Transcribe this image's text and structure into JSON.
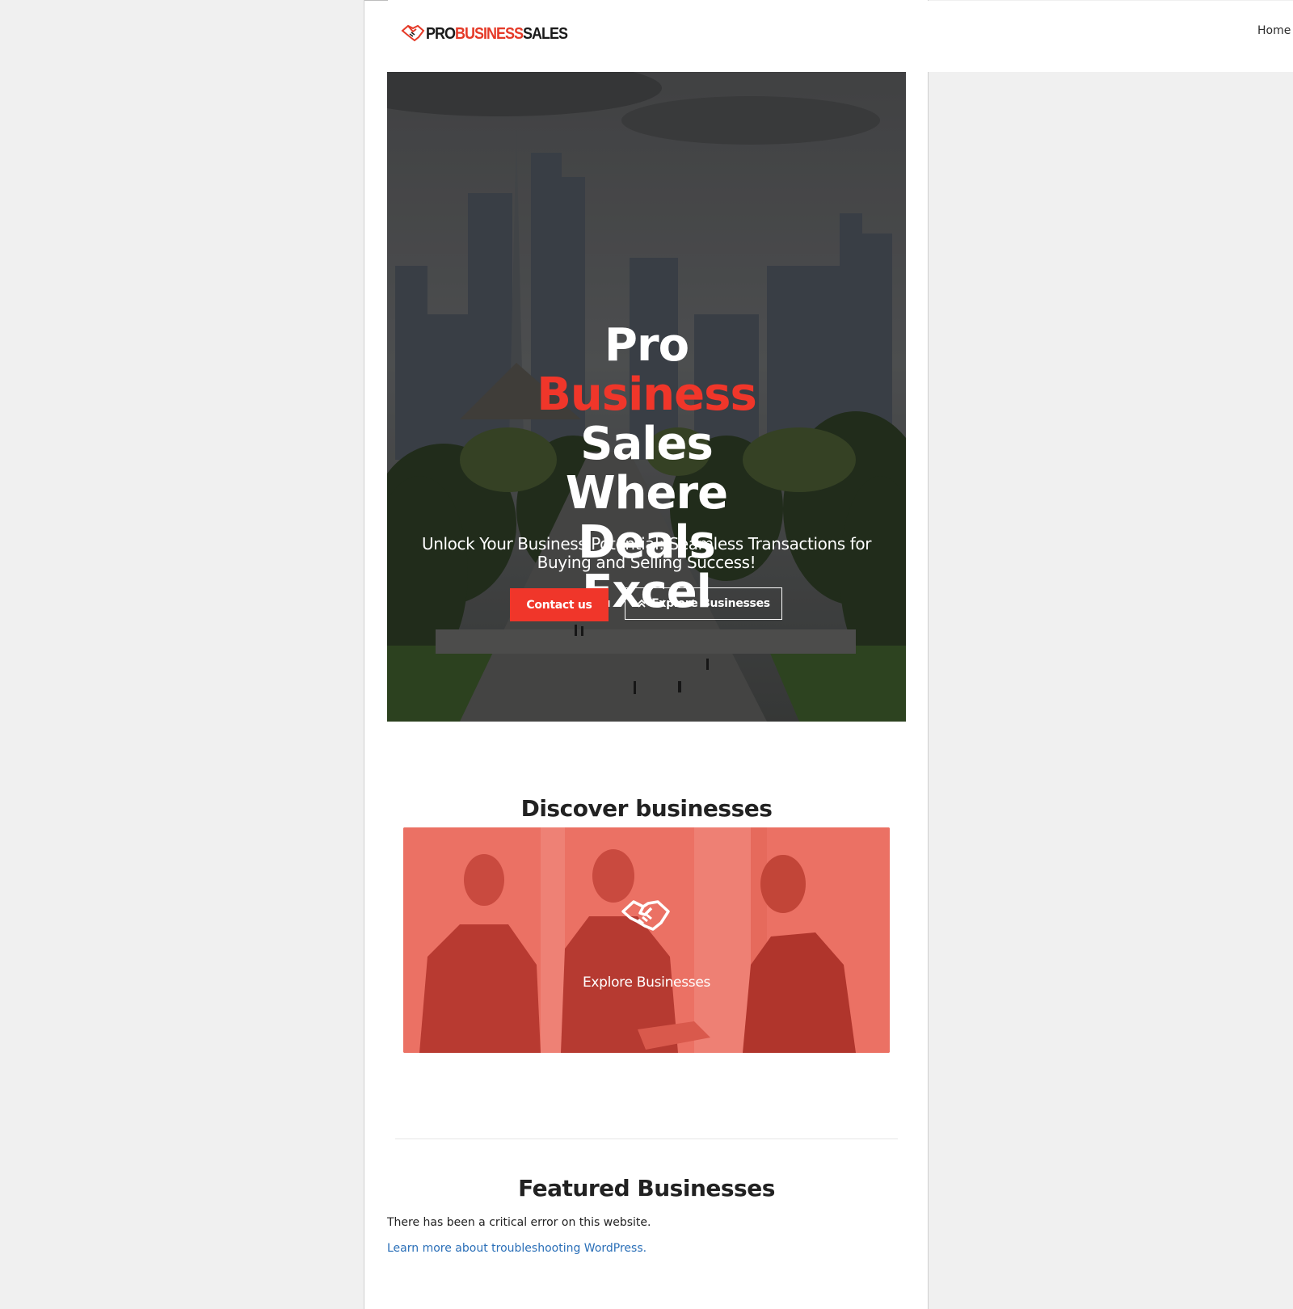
{
  "header": {
    "logo": {
      "part1": "PRO",
      "part2": "BUSINESS",
      "part3": "SALES"
    },
    "nav": {
      "home": "Home"
    }
  },
  "hero": {
    "title_lines": [
      "Pro",
      "Business",
      "Sales",
      "Where",
      "Deals",
      "Excel"
    ],
    "subtitle": "Unlock Your Business Potential: Seamless Transactions for Buying and Selling Success!",
    "contact_button": "Contact us",
    "explore_button": "Explore Businesses"
  },
  "discover": {
    "title": "Discover businesses",
    "card_label": "Explore Businesses",
    "card_icon": "handshake-icon"
  },
  "featured": {
    "title": "Featured Businesses",
    "error_message": "There has been a critical error on this website.",
    "help_link": "Learn more about troubleshooting WordPress."
  },
  "colors": {
    "accent": "#f0362a",
    "link": "#2a6fb8",
    "card_overlay": "#e96a5c"
  }
}
